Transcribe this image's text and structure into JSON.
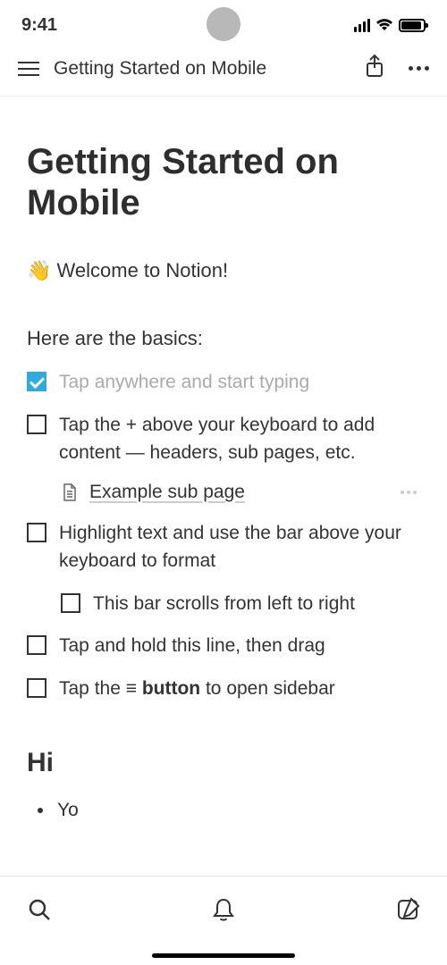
{
  "status": {
    "time": "9:41"
  },
  "nav": {
    "breadcrumb": "Getting Started on Mobile"
  },
  "page": {
    "title": "Getting Started on Mobile",
    "welcome_emoji": "👋",
    "welcome_text": "Welcome to Notion!",
    "basics_intro": "Here are the basics:",
    "todo1": "Tap anywhere and start typing",
    "todo2": "Tap the + above your keyboard to add content — headers, sub pages, etc.",
    "subpage_label": "Example sub page",
    "todo3": "Highlight text and use the bar above your keyboard to format",
    "todo3a": "This bar scrolls from left to right",
    "todo4": "Tap and hold this line, then drag",
    "todo5_pre": "Tap the ",
    "todo5_icon": "≡",
    "todo5_bold": " button",
    "todo5_post": " to open sidebar",
    "heading": "Hi",
    "bullet1": "Yo"
  }
}
